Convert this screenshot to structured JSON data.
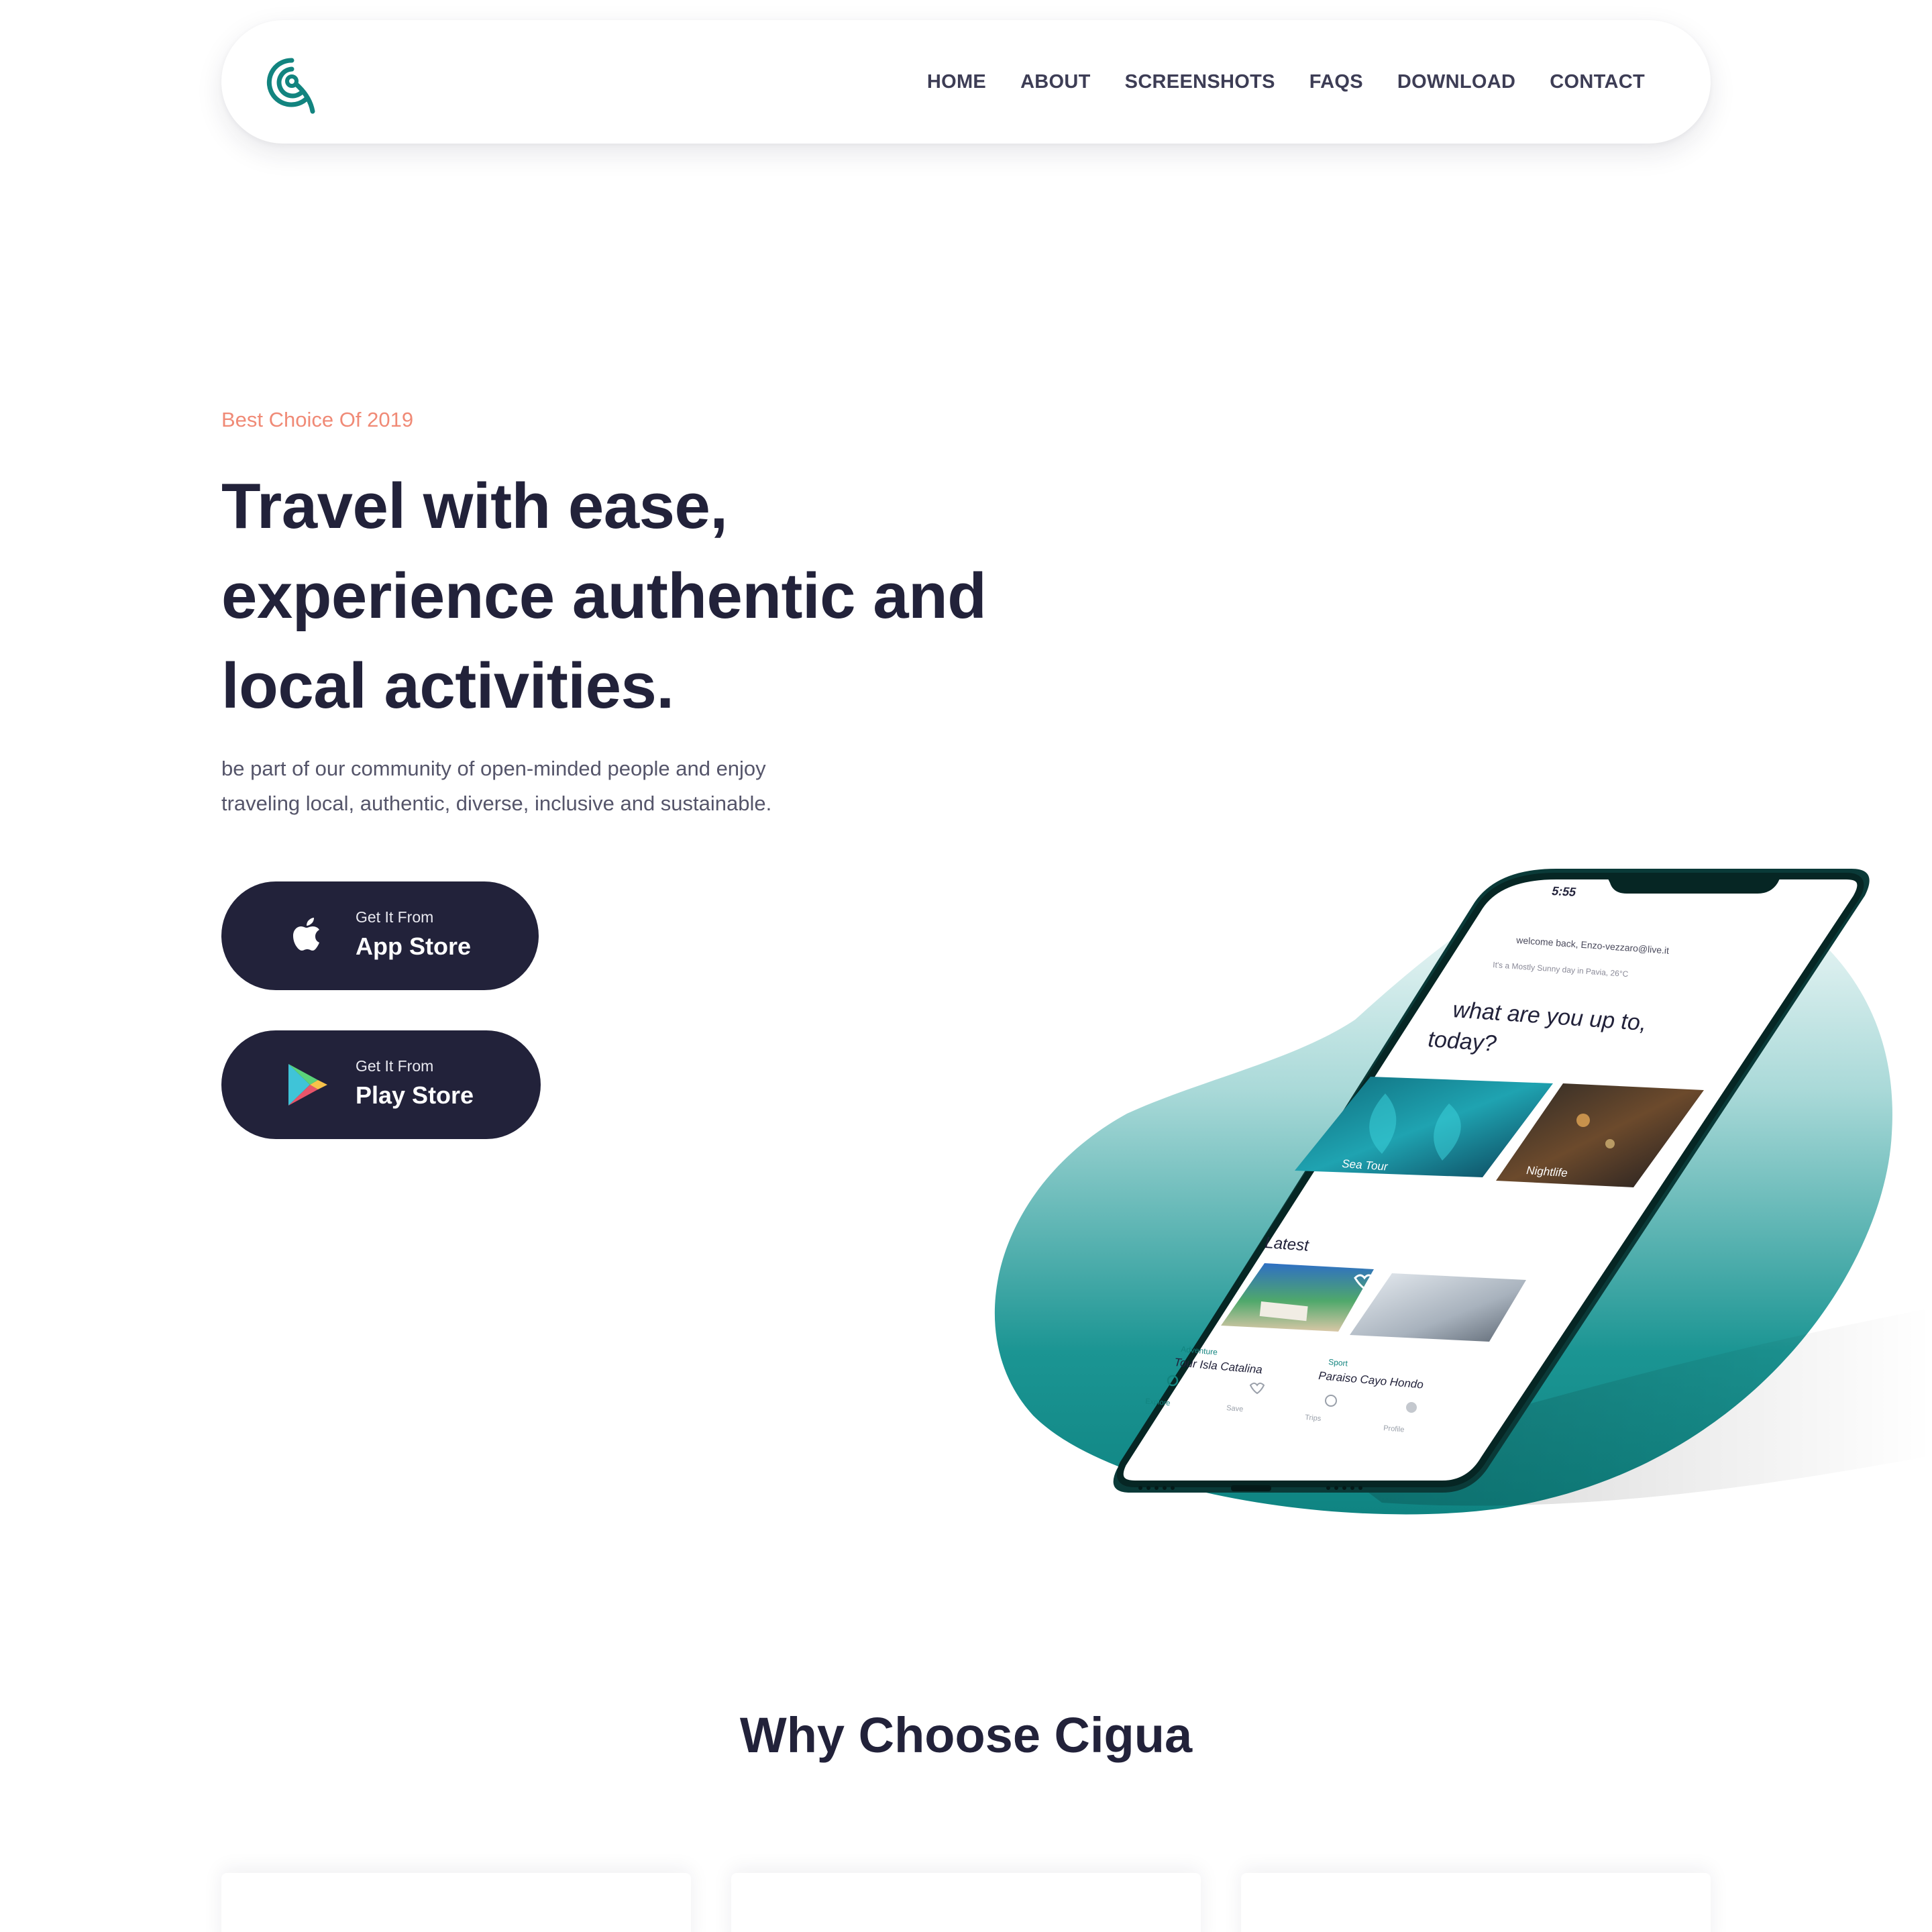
{
  "brand": {
    "accent": "#12847f",
    "dark": "#22223a",
    "coral": "#f08a76"
  },
  "nav": {
    "items": [
      {
        "label": "HOME"
      },
      {
        "label": "ABOUT"
      },
      {
        "label": "SCREENSHOTS"
      },
      {
        "label": "FAQS"
      },
      {
        "label": "DOWNLOAD"
      },
      {
        "label": "CONTACT"
      }
    ]
  },
  "hero": {
    "eyebrow": "Best Choice Of 2019",
    "headline_lines": [
      "Travel with ease,",
      "experience authentic and",
      "local activities."
    ],
    "lead_lines": [
      "be part of our community of open-minded people and enjoy",
      "traveling local, authentic, diverse, inclusive and sustainable."
    ],
    "app_store": {
      "small": "Get It From",
      "big": "App Store",
      "icon": "apple-icon"
    },
    "play_store": {
      "small": "Get It From",
      "big": "Play Store",
      "icon": "play-store-icon"
    }
  },
  "phone": {
    "time": "5:55",
    "welcome": "welcome back, Enzo-vezzaro@live.it",
    "weather": "It's a Mostly Sunny day in Pavia, 26°C",
    "question": [
      "what are you up to,",
      "today?"
    ],
    "categories": [
      {
        "label": "Sea Tour"
      },
      {
        "label": "Nightlife"
      }
    ],
    "latest_title": "Latest",
    "latest": [
      {
        "tag": "Adventure",
        "title": "Tour Isla Catalina"
      },
      {
        "tag": "Sport",
        "title": "Paraiso Cayo Hondo"
      }
    ],
    "tabs": [
      {
        "label": "Explore"
      },
      {
        "label": "Save"
      },
      {
        "label": "Trips"
      },
      {
        "label": "Profile"
      }
    ]
  },
  "section": {
    "title": "Why Choose Cigua"
  }
}
